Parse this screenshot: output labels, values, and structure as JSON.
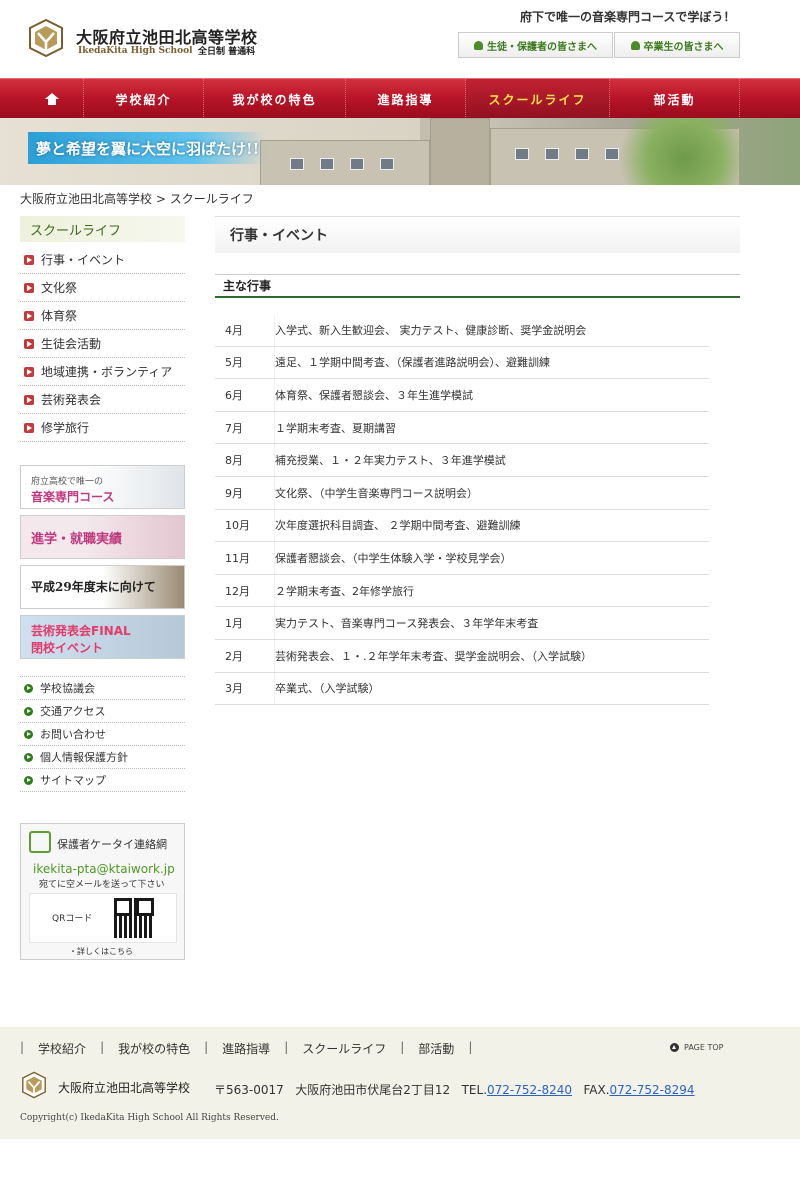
{
  "header": {
    "school_name": "大阪府立池田北高等学校",
    "school_name_en": "IkedaKita High School",
    "school_course": "全日制 普通科",
    "tagline": "府下で唯一の音楽専門コースで学ぼう！",
    "students_button": "生徒・保護者の皆さまへ",
    "alumni_button": "卒業生の皆さまへ"
  },
  "nav": {
    "home_icon": "home-icon",
    "items": [
      "学校紹介",
      "我が校の特色",
      "進路指導",
      "スクールライフ",
      "部活動"
    ],
    "active": "スクールライフ"
  },
  "banner": {
    "text": "夢と希望を翼に大空に羽ばたけ!!"
  },
  "breadcrumb": {
    "home": "大阪府立池田北高等学校",
    "separator": ">",
    "current": "スクールライフ"
  },
  "sidebar": {
    "title": "スクールライフ",
    "items": [
      "行事・イベント",
      "文化祭",
      "体育祭",
      "生徒会活動",
      "地域連携・ボランティア",
      "芸術発表会",
      "修学旅行"
    ],
    "banners": {
      "music_small": "府立高校で唯一の",
      "music_big": "音楽専門コース",
      "career": "進学・就職実績",
      "closing": "平成29年度末に向けて",
      "final_line1": "芸術発表会FINAL",
      "final_line2": "閉校イベント"
    },
    "links": [
      "学校協議会",
      "交通アクセス",
      "お問い合わせ",
      "個人情報保護方針",
      "サイトマップ"
    ],
    "mobile": {
      "title": "保護者ケータイ連絡網",
      "email": "ikekita-pta@ktaiwork.jp",
      "note": "宛てに空メールを送って下さい",
      "qr_label": "QRコード",
      "more": "・詳しくはこちら"
    }
  },
  "main": {
    "page_heading": "行事・イベント",
    "section_heading": "主な行事",
    "events": [
      {
        "month": "4月",
        "desc": "入学式、新入生歓迎会、 実力テスト、健康診断、奨学金説明会"
      },
      {
        "month": "5月",
        "desc": "遠足、１学期中間考査、（保護者進路説明会）、避難訓練"
      },
      {
        "month": "6月",
        "desc": "体育祭、保護者懇談会、３年生進学模試"
      },
      {
        "month": "7月",
        "desc": " １学期末考査、夏期講習"
      },
      {
        "month": "8月",
        "desc": "補充授業、１・２年実力テスト、３年進学模試"
      },
      {
        "month": "9月",
        "desc": "文化祭、（中学生音楽専門コース説明会）"
      },
      {
        "month": "10月",
        "desc": "次年度選択科目調査、 ２学期中間考査、避難訓練"
      },
      {
        "month": "11月",
        "desc": "保護者懇談会、（中学生体験入学・学校見学会）"
      },
      {
        "month": "12月",
        "desc": " ２学期末考査、2年修学旅行"
      },
      {
        "month": "1月",
        "desc": "実力テスト、音楽専門コース発表会、３年学年末考査"
      },
      {
        "month": "2月",
        "desc": "芸術発表会、１・.２年学年末考査、奨学金説明会、（入学試験）"
      },
      {
        "month": "3月",
        "desc": "卒業式、（入学試験）"
      }
    ]
  },
  "footer": {
    "nav": [
      "学校紹介",
      "我が校の特色",
      "進路指導",
      "スクールライフ",
      "部活動"
    ],
    "page_top": "PAGE TOP",
    "school_name": "大阪府立池田北高等学校",
    "postal": "〒563-0017",
    "address": "大阪府池田市伏尾台2丁目12",
    "tel_label": "TEL.",
    "tel": "072-752-8240",
    "fax_label": "FAX.",
    "fax": "072-752-8294",
    "copyright": "Copyright(c) IkedaKita High School All Rights Reserved."
  },
  "colors": {
    "nav_red": "#b81427",
    "nav_active_text": "#ffe14d",
    "accent_green": "#2d6a2d",
    "link_blue": "#2b63c4"
  }
}
